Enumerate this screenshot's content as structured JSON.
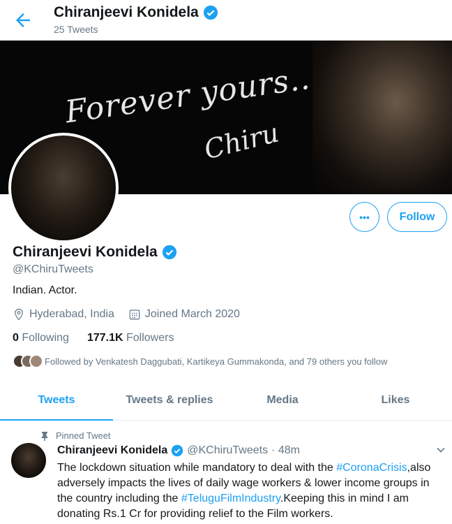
{
  "header": {
    "name": "Chiranjeevi Konidela",
    "tweet_count": "25 Tweets"
  },
  "banner": {
    "text": "Forever yours...",
    "signature": "Chiru"
  },
  "profile": {
    "name": "Chiranjeevi Konidela",
    "handle": "@KChiruTweets",
    "bio": "Indian. Actor.",
    "location": "Hyderabad, India",
    "joined": "Joined March 2020",
    "following_count": "0",
    "following_label": "Following",
    "followers_count": "177.1K",
    "followers_label": "Followers",
    "followed_by": "Followed by Venkatesh Daggubati, Kartikeya Gummakonda, and 79 others you follow"
  },
  "actions": {
    "more_label": "•••",
    "follow_label": "Follow"
  },
  "tabs": [
    {
      "label": "Tweets"
    },
    {
      "label": "Tweets & replies"
    },
    {
      "label": "Media"
    },
    {
      "label": "Likes"
    }
  ],
  "tweet": {
    "pinned_label": "Pinned Tweet",
    "name": "Chiranjeevi Konidela",
    "handle": "@KChiruTweets",
    "time": "· 48m",
    "text1": "The lockdown situation while mandatory to deal with the ",
    "tag1": "#CoronaCrisis",
    "text2": ",also adversely impacts the lives of daily wage workers & lower income groups in the country including the ",
    "tag2": "#TeluguFilmIndustry",
    "text3": ".Keeping this in mind I am donating Rs.1 Cr for providing relief to the Film workers."
  },
  "colors": {
    "accent": "#1da1f2",
    "secondary_text": "#657786"
  }
}
